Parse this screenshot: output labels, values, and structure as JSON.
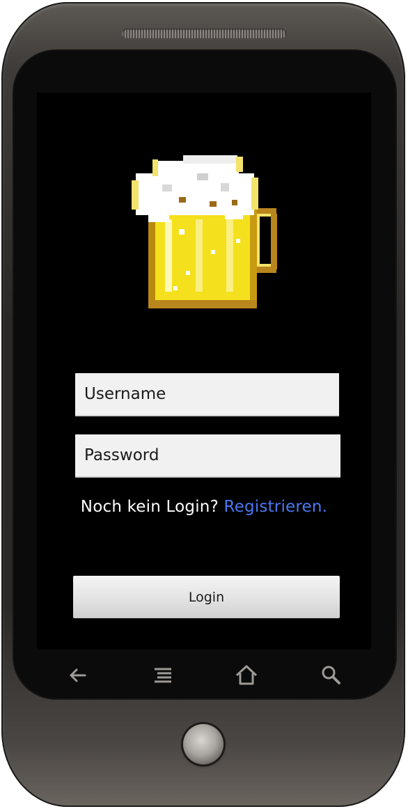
{
  "login_form": {
    "username_placeholder": "Username",
    "password_placeholder": "Password",
    "register_prompt": "Noch kein Login?",
    "register_link": "Registrieren.",
    "login_button": "Login"
  },
  "logo": {
    "icon": "beer-mug-icon"
  },
  "colors": {
    "screen_background": "#000000",
    "link": "#4a78f0",
    "input_background": "#f1f1f1",
    "beer": "#f7e21a",
    "foam": "#ffffff"
  },
  "device_nav": {
    "back_icon": "back-arrow-icon",
    "menu_icon": "menu-icon",
    "home_icon": "home-icon",
    "search_icon": "search-icon"
  }
}
